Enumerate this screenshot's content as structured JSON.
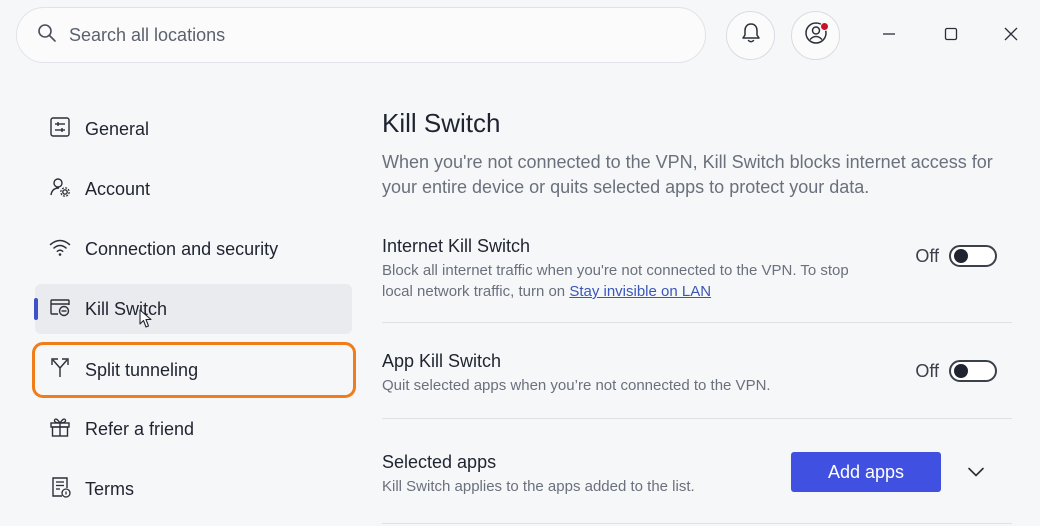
{
  "search": {
    "placeholder": "Search all locations"
  },
  "header": {
    "notifications_icon": "bell-icon",
    "profile_icon": "profile-icon",
    "profile_has_alert": true
  },
  "window_controls": [
    "minimize",
    "maximize",
    "close"
  ],
  "sidebar": {
    "items": [
      {
        "label": "General",
        "icon": "sliders-icon"
      },
      {
        "label": "Account",
        "icon": "account-settings-icon"
      },
      {
        "label": "Connection and security",
        "icon": "wifi-icon"
      },
      {
        "label": "Kill Switch",
        "icon": "kill-switch-icon",
        "active": true
      },
      {
        "label": "Split tunneling",
        "icon": "split-arrows-icon",
        "highlighted": true
      },
      {
        "label": "Refer a friend",
        "icon": "gift-icon"
      },
      {
        "label": "Terms",
        "icon": "terms-document-icon"
      }
    ]
  },
  "main": {
    "title": "Kill Switch",
    "description": "When you're not connected to the VPN, Kill Switch blocks internet access for your entire device or quits selected apps to protect your data.",
    "internet_kill_switch": {
      "title": "Internet Kill Switch",
      "desc_prefix": "Block all internet traffic when you're not connected to the VPN. To stop local network traffic, turn on ",
      "desc_link": "Stay invisible on LAN",
      "state": "Off"
    },
    "app_kill_switch": {
      "title": "App Kill Switch",
      "desc": "Quit selected apps when you’re not connected to the VPN.",
      "state": "Off"
    },
    "selected_apps": {
      "title": "Selected apps",
      "desc": "Kill Switch applies to the apps added to the list.",
      "button": "Add apps"
    }
  },
  "colors": {
    "accent": "#4050e0",
    "active_indicator": "#3f51c8",
    "highlight_outline": "#f07d1a",
    "alert_dot": "#c4152b"
  }
}
